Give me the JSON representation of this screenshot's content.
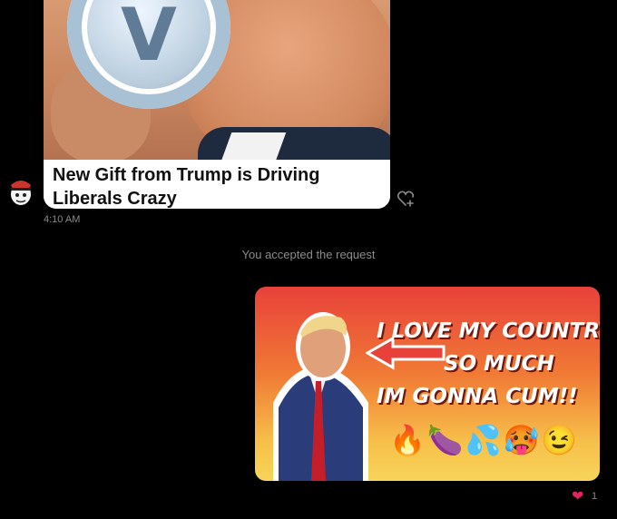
{
  "incoming": {
    "headline": "New Gift from Trump is Driving Liberals Crazy",
    "timestamp": "4:10 AM",
    "coin_letter": "V"
  },
  "system_message": "You accepted the request",
  "outgoing": {
    "meme_line1": "I LOVE MY COUNTRY",
    "meme_line2": "SO MUCH",
    "meme_line3": "IM GONNA CUM!!",
    "emojis": "🔥🍆💦🥵😉",
    "reaction_count": "1"
  },
  "colors": {
    "background": "#000000",
    "meta_text": "#8b8b8b",
    "like_heart": "#e0245e"
  },
  "icons": [
    "avatar-icon",
    "add-reaction-icon",
    "heart-icon",
    "arrow-icon"
  ]
}
